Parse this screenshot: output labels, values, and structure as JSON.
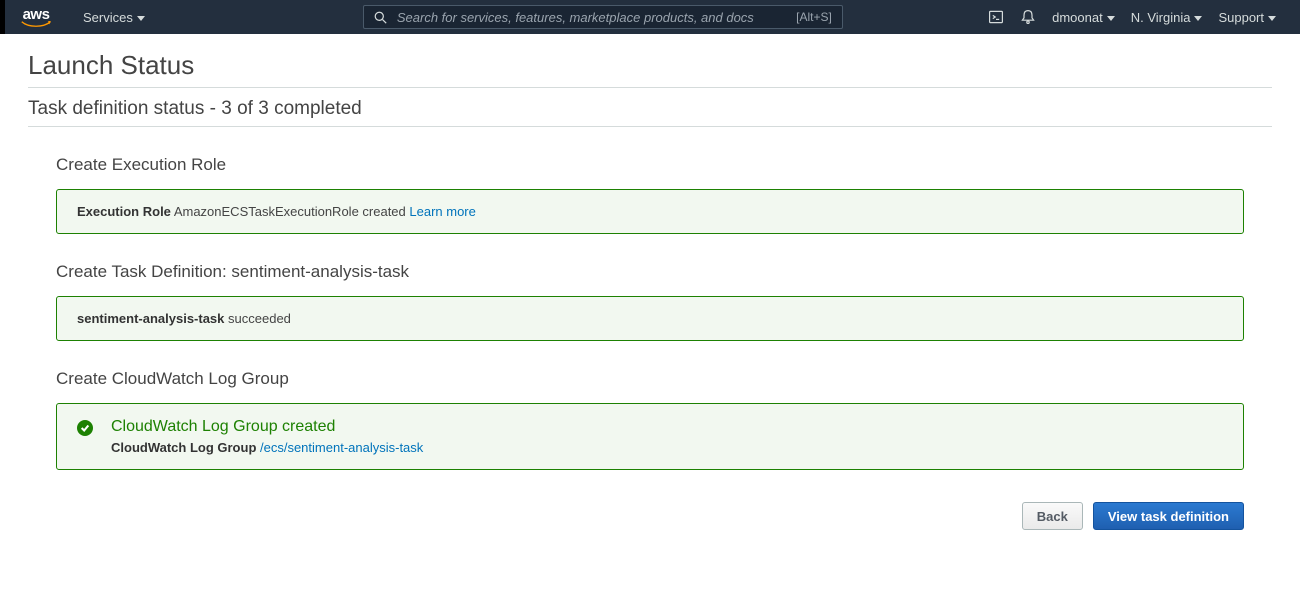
{
  "nav": {
    "services": "Services",
    "search_placeholder": "Search for services, features, marketplace products, and docs",
    "search_hint": "[Alt+S]",
    "user": "dmoonat",
    "region": "N. Virginia",
    "support": "Support"
  },
  "page": {
    "title": "Launch Status",
    "subtitle": "Task definition status - 3 of 3 completed"
  },
  "sections": {
    "exec_role": {
      "heading": "Create Execution Role",
      "bold": "Execution Role",
      "text": " AmazonECSTaskExecutionRole created ",
      "link": "Learn more"
    },
    "task_def": {
      "heading": "Create Task Definition: sentiment-analysis-task",
      "bold": "sentiment-analysis-task",
      "text": " succeeded"
    },
    "log_group": {
      "heading": "Create CloudWatch Log Group",
      "success_heading": "CloudWatch Log Group created",
      "sub_bold": "CloudWatch Log Group ",
      "sub_link": "/ecs/sentiment-analysis-task"
    }
  },
  "footer": {
    "back": "Back",
    "view": "View task definition"
  }
}
